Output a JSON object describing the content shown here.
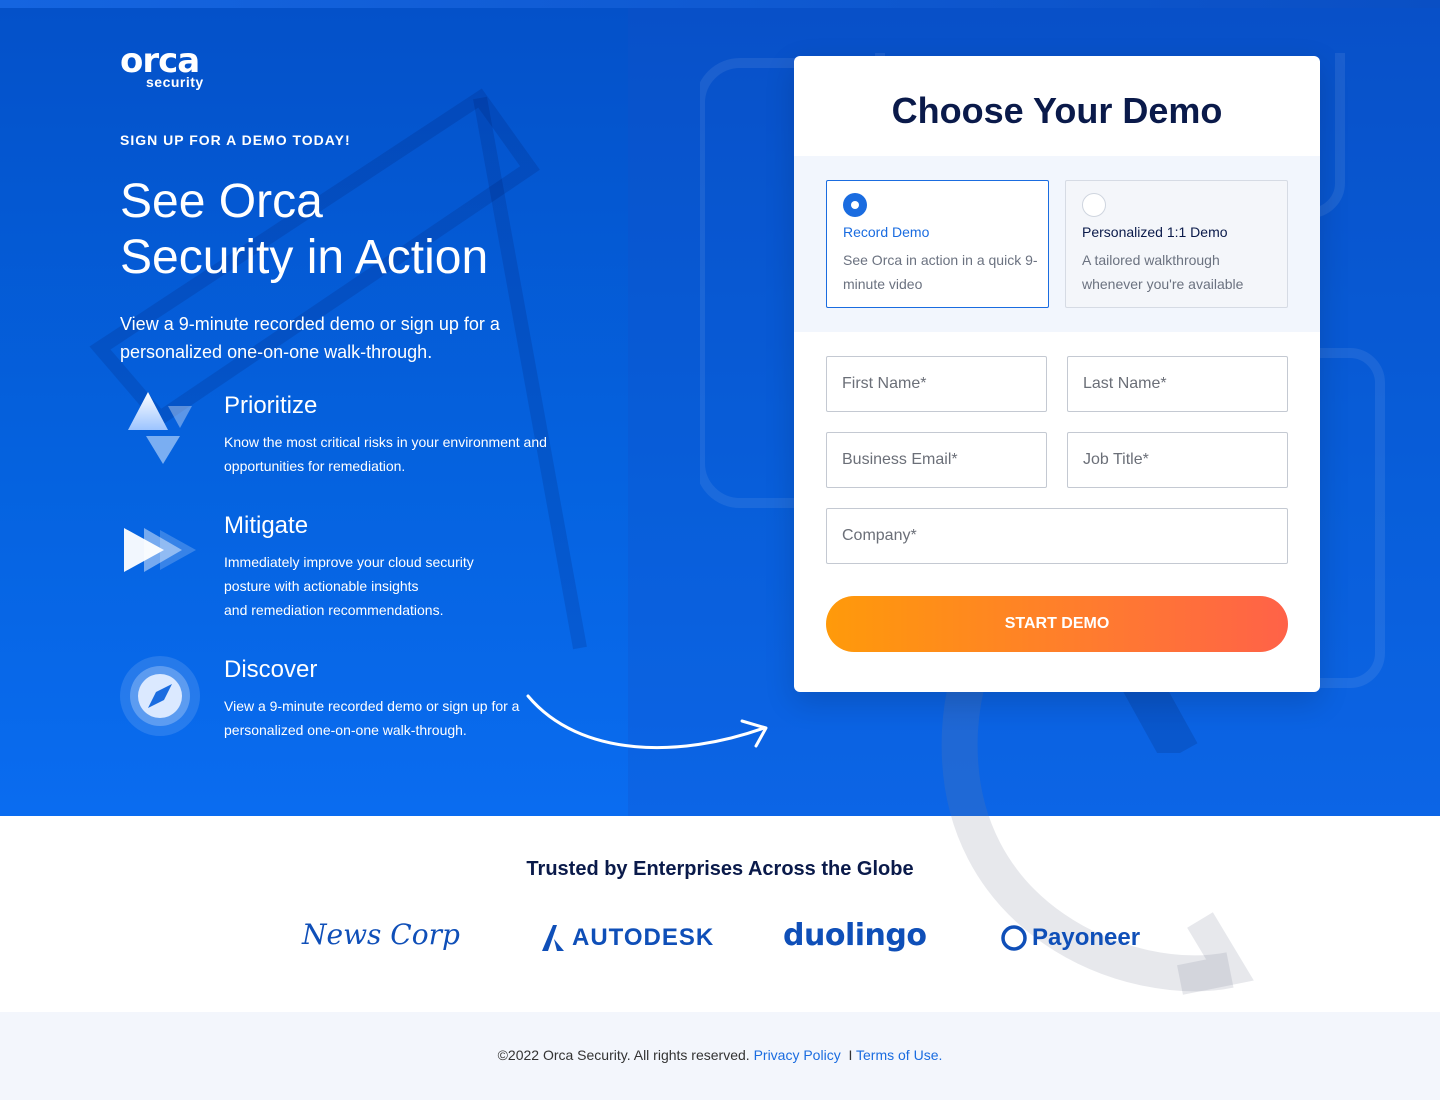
{
  "brand": {
    "logo_main": "orca",
    "logo_sub": "security"
  },
  "hero": {
    "eyebrow": "SIGN UP FOR A DEMO TODAY!",
    "headline_line1": "See Orca",
    "headline_line2": "Security in Action",
    "subhead": "View a 9-minute recorded demo or sign up for a personalized one-on-one walk-through."
  },
  "features": [
    {
      "icon": "prioritize-arrows-icon",
      "title": "Prioritize",
      "description": "Know the most critical risks in your environment and opportunities for remediation."
    },
    {
      "icon": "mitigate-fast-forward-icon",
      "title": "Mitigate",
      "description_lines": [
        "Immediately improve your cloud security",
        "posture with actionable insights",
        "and remediation recommendations."
      ]
    },
    {
      "icon": "discover-compass-icon",
      "title": "Discover",
      "description": "View a 9-minute recorded demo or sign up for a personalized one-on-one walk-through."
    }
  ],
  "form": {
    "title": "Choose Your Demo",
    "options": [
      {
        "title": "Record Demo",
        "description": "See Orca in action in a quick 9-minute video",
        "selected": true
      },
      {
        "title": "Personalized 1:1 Demo",
        "description": "A tailored walkthrough whenever you're available",
        "selected": false
      }
    ],
    "fields": {
      "first_name": "First Name*",
      "last_name": "Last Name*",
      "business_email": "Business Email*",
      "job_title": "Job Title*",
      "company": "Company*"
    },
    "submit_label": "START DEMO"
  },
  "trusted": {
    "heading": "Trusted by Enterprises Across the Globe",
    "logos": [
      "News Corp",
      "AUTODESK",
      "duolingo",
      "Payoneer"
    ]
  },
  "footer": {
    "copyright": "©2022 Orca Security. All rights reserved.",
    "privacy_link": "Privacy Policy",
    "separator": "I",
    "terms_link": "Terms of Use."
  },
  "colors": {
    "hero_blue": "#0563e0",
    "accent_blue": "#1a6ce0",
    "cta_orange": "#ff8a1a",
    "navy": "#0a1a4a"
  }
}
